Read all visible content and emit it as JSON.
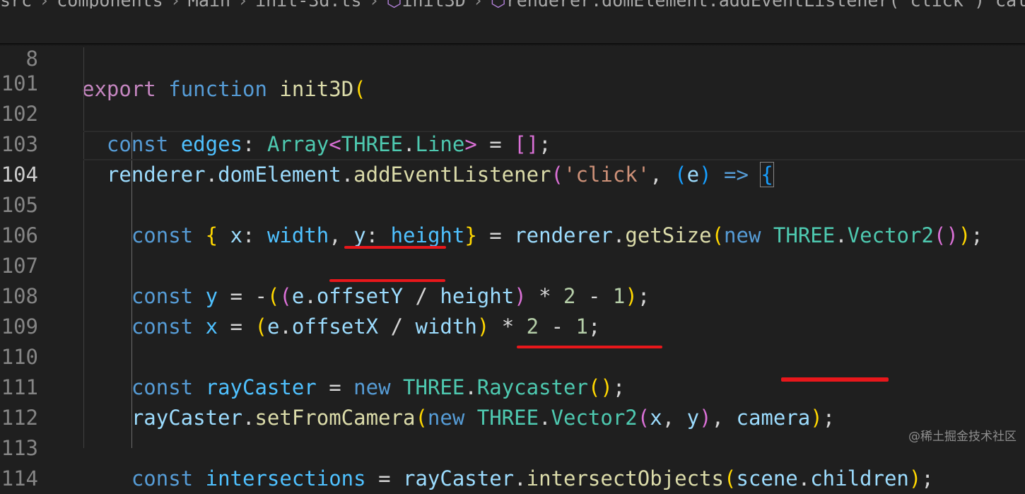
{
  "breadcrumb": [
    "src",
    "components",
    "Main",
    "init-3d.ts",
    "init3D",
    "renderer.domElement.addEventListener('click') callback"
  ],
  "sticky": {
    "line_number": "8",
    "code": "export function init3D("
  },
  "lines": [
    {
      "n": "101"
    },
    {
      "n": "102"
    },
    {
      "n": "103"
    },
    {
      "n": "104"
    },
    {
      "n": "105"
    },
    {
      "n": "106"
    },
    {
      "n": "107"
    },
    {
      "n": "108"
    },
    {
      "n": "109"
    },
    {
      "n": "110"
    },
    {
      "n": "111"
    },
    {
      "n": "112"
    },
    {
      "n": "113"
    },
    {
      "n": "114"
    }
  ],
  "active_line": "104",
  "watermark": "@稀土掘金技术社区",
  "colors": {
    "background": "#1f1f1f",
    "annotation_underline": "#e8171b"
  }
}
